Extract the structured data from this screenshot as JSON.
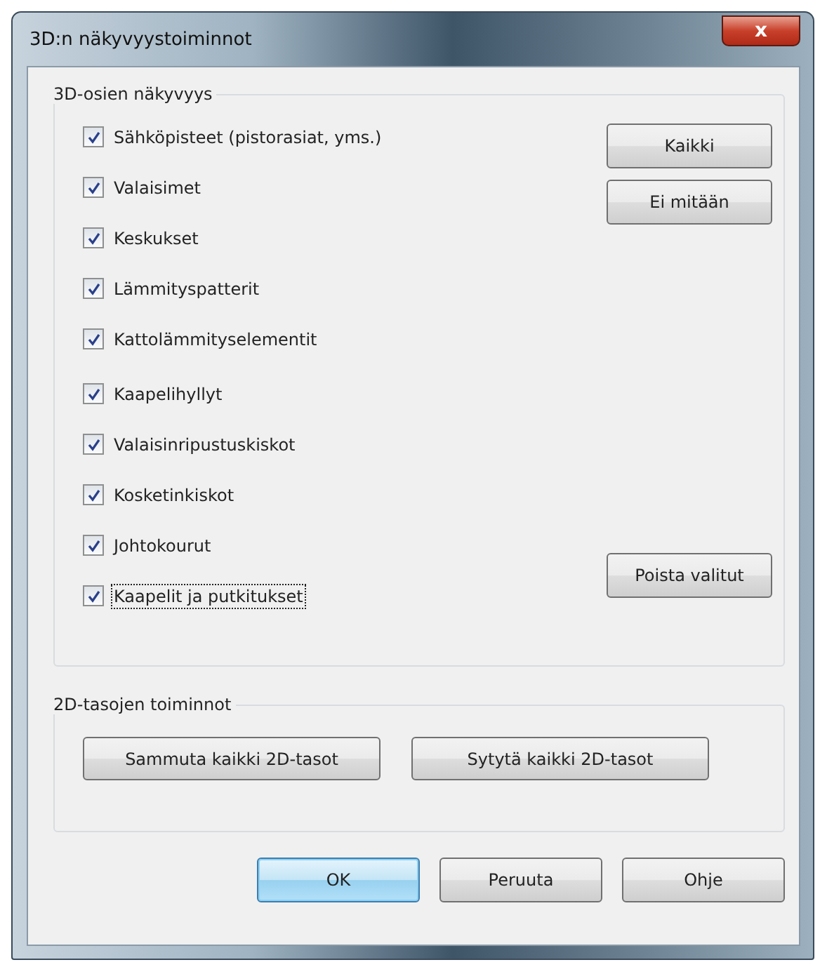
{
  "window": {
    "title": "3D:n näkyvyystoiminnot",
    "close_label": "x"
  },
  "visibility_group": {
    "title": "3D-osien näkyvyys",
    "checkbox_groups": [
      [
        {
          "label": "Sähköpisteet (pistorasiat, yms.)",
          "checked": true,
          "focused": false
        },
        {
          "label": "Valaisimet",
          "checked": true,
          "focused": false
        },
        {
          "label": "Keskukset",
          "checked": true,
          "focused": false
        },
        {
          "label": "Lämmityspatterit",
          "checked": true,
          "focused": false
        },
        {
          "label": "Kattolämmityselementit",
          "checked": true,
          "focused": false
        }
      ],
      [
        {
          "label": "Kaapelihyllyt",
          "checked": true,
          "focused": false
        },
        {
          "label": "Valaisinripustuskiskot",
          "checked": true,
          "focused": false
        },
        {
          "label": "Kosketinkiskot",
          "checked": true,
          "focused": false
        },
        {
          "label": "Johtokourut",
          "checked": true,
          "focused": false
        },
        {
          "label": "Kaapelit ja putkitukset",
          "checked": true,
          "focused": true
        }
      ]
    ],
    "top_buttons": [
      "Kaikki",
      "Ei mitään"
    ],
    "bottom_button": "Poista valitut"
  },
  "layers_group": {
    "title": "2D-tasojen toiminnot",
    "buttons": [
      "Sammuta kaikki 2D-tasot",
      "Sytytä kaikki 2D-tasot"
    ]
  },
  "dialog_buttons": [
    {
      "label": "OK",
      "default": true
    },
    {
      "label": "Peruuta",
      "default": false
    },
    {
      "label": "Ohje",
      "default": false
    }
  ]
}
